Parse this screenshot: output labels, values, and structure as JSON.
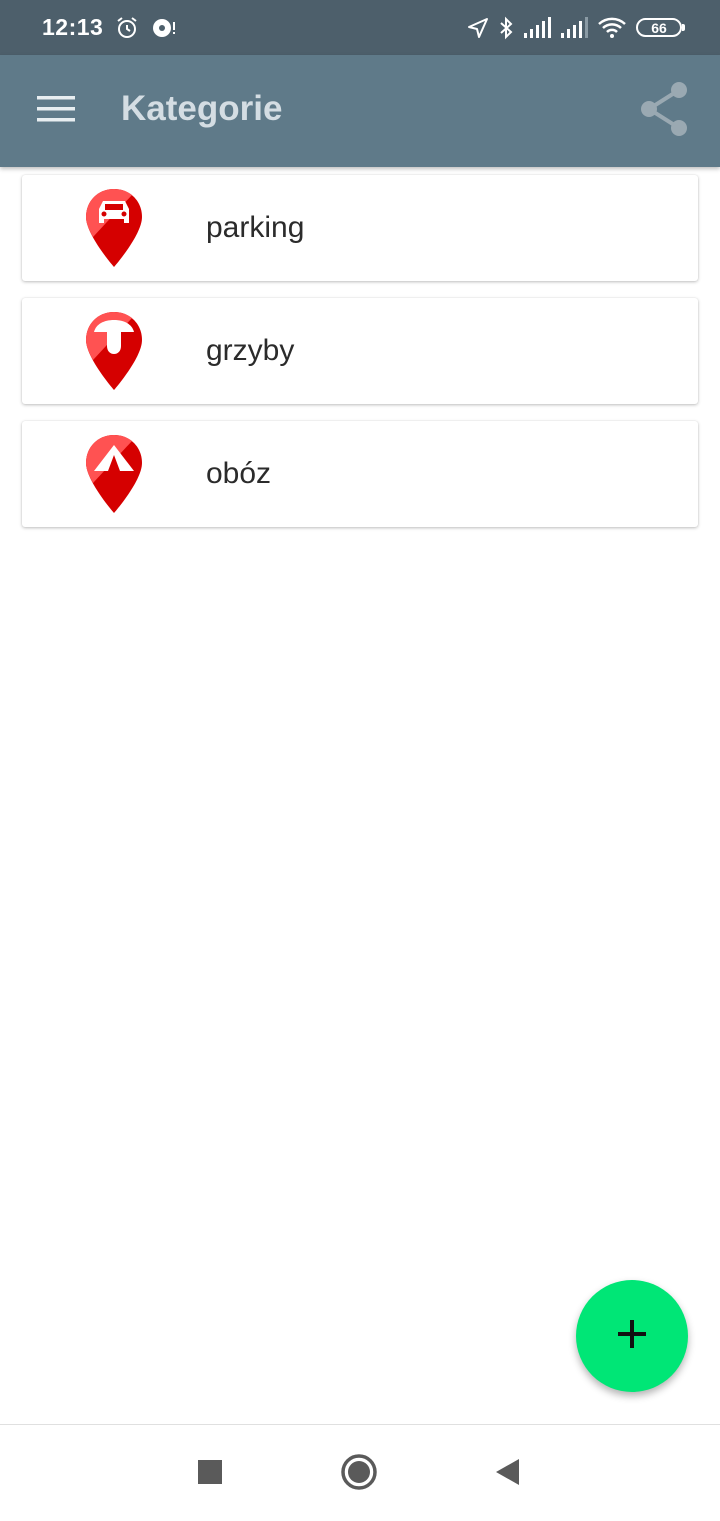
{
  "status_bar": {
    "time": "12:13",
    "battery": "66",
    "icons": [
      "alarm-icon",
      "vinyl-icon",
      "location-arrow-icon",
      "bluetooth-icon",
      "signal-icon",
      "signal-icon",
      "wifi-icon",
      "battery-icon"
    ]
  },
  "app_bar": {
    "title": "Kategorie",
    "icons": [
      "menu-icon",
      "share-icon"
    ]
  },
  "categories": [
    {
      "label": "parking",
      "icon": "car-pin-icon"
    },
    {
      "label": "grzyby",
      "icon": "mushroom-pin-icon"
    },
    {
      "label": "obóz",
      "icon": "tent-pin-icon"
    }
  ],
  "fab": {
    "icon": "plus-icon",
    "color": "#00e676"
  },
  "nav_bar": {
    "icons": [
      "recents-square-icon",
      "home-circle-icon",
      "back-triangle-icon"
    ]
  },
  "colors": {
    "status_bar": "#4d5f6b",
    "app_bar": "#5f7a89",
    "pin_red": "#d50000",
    "pin_light": "#ff5252"
  }
}
